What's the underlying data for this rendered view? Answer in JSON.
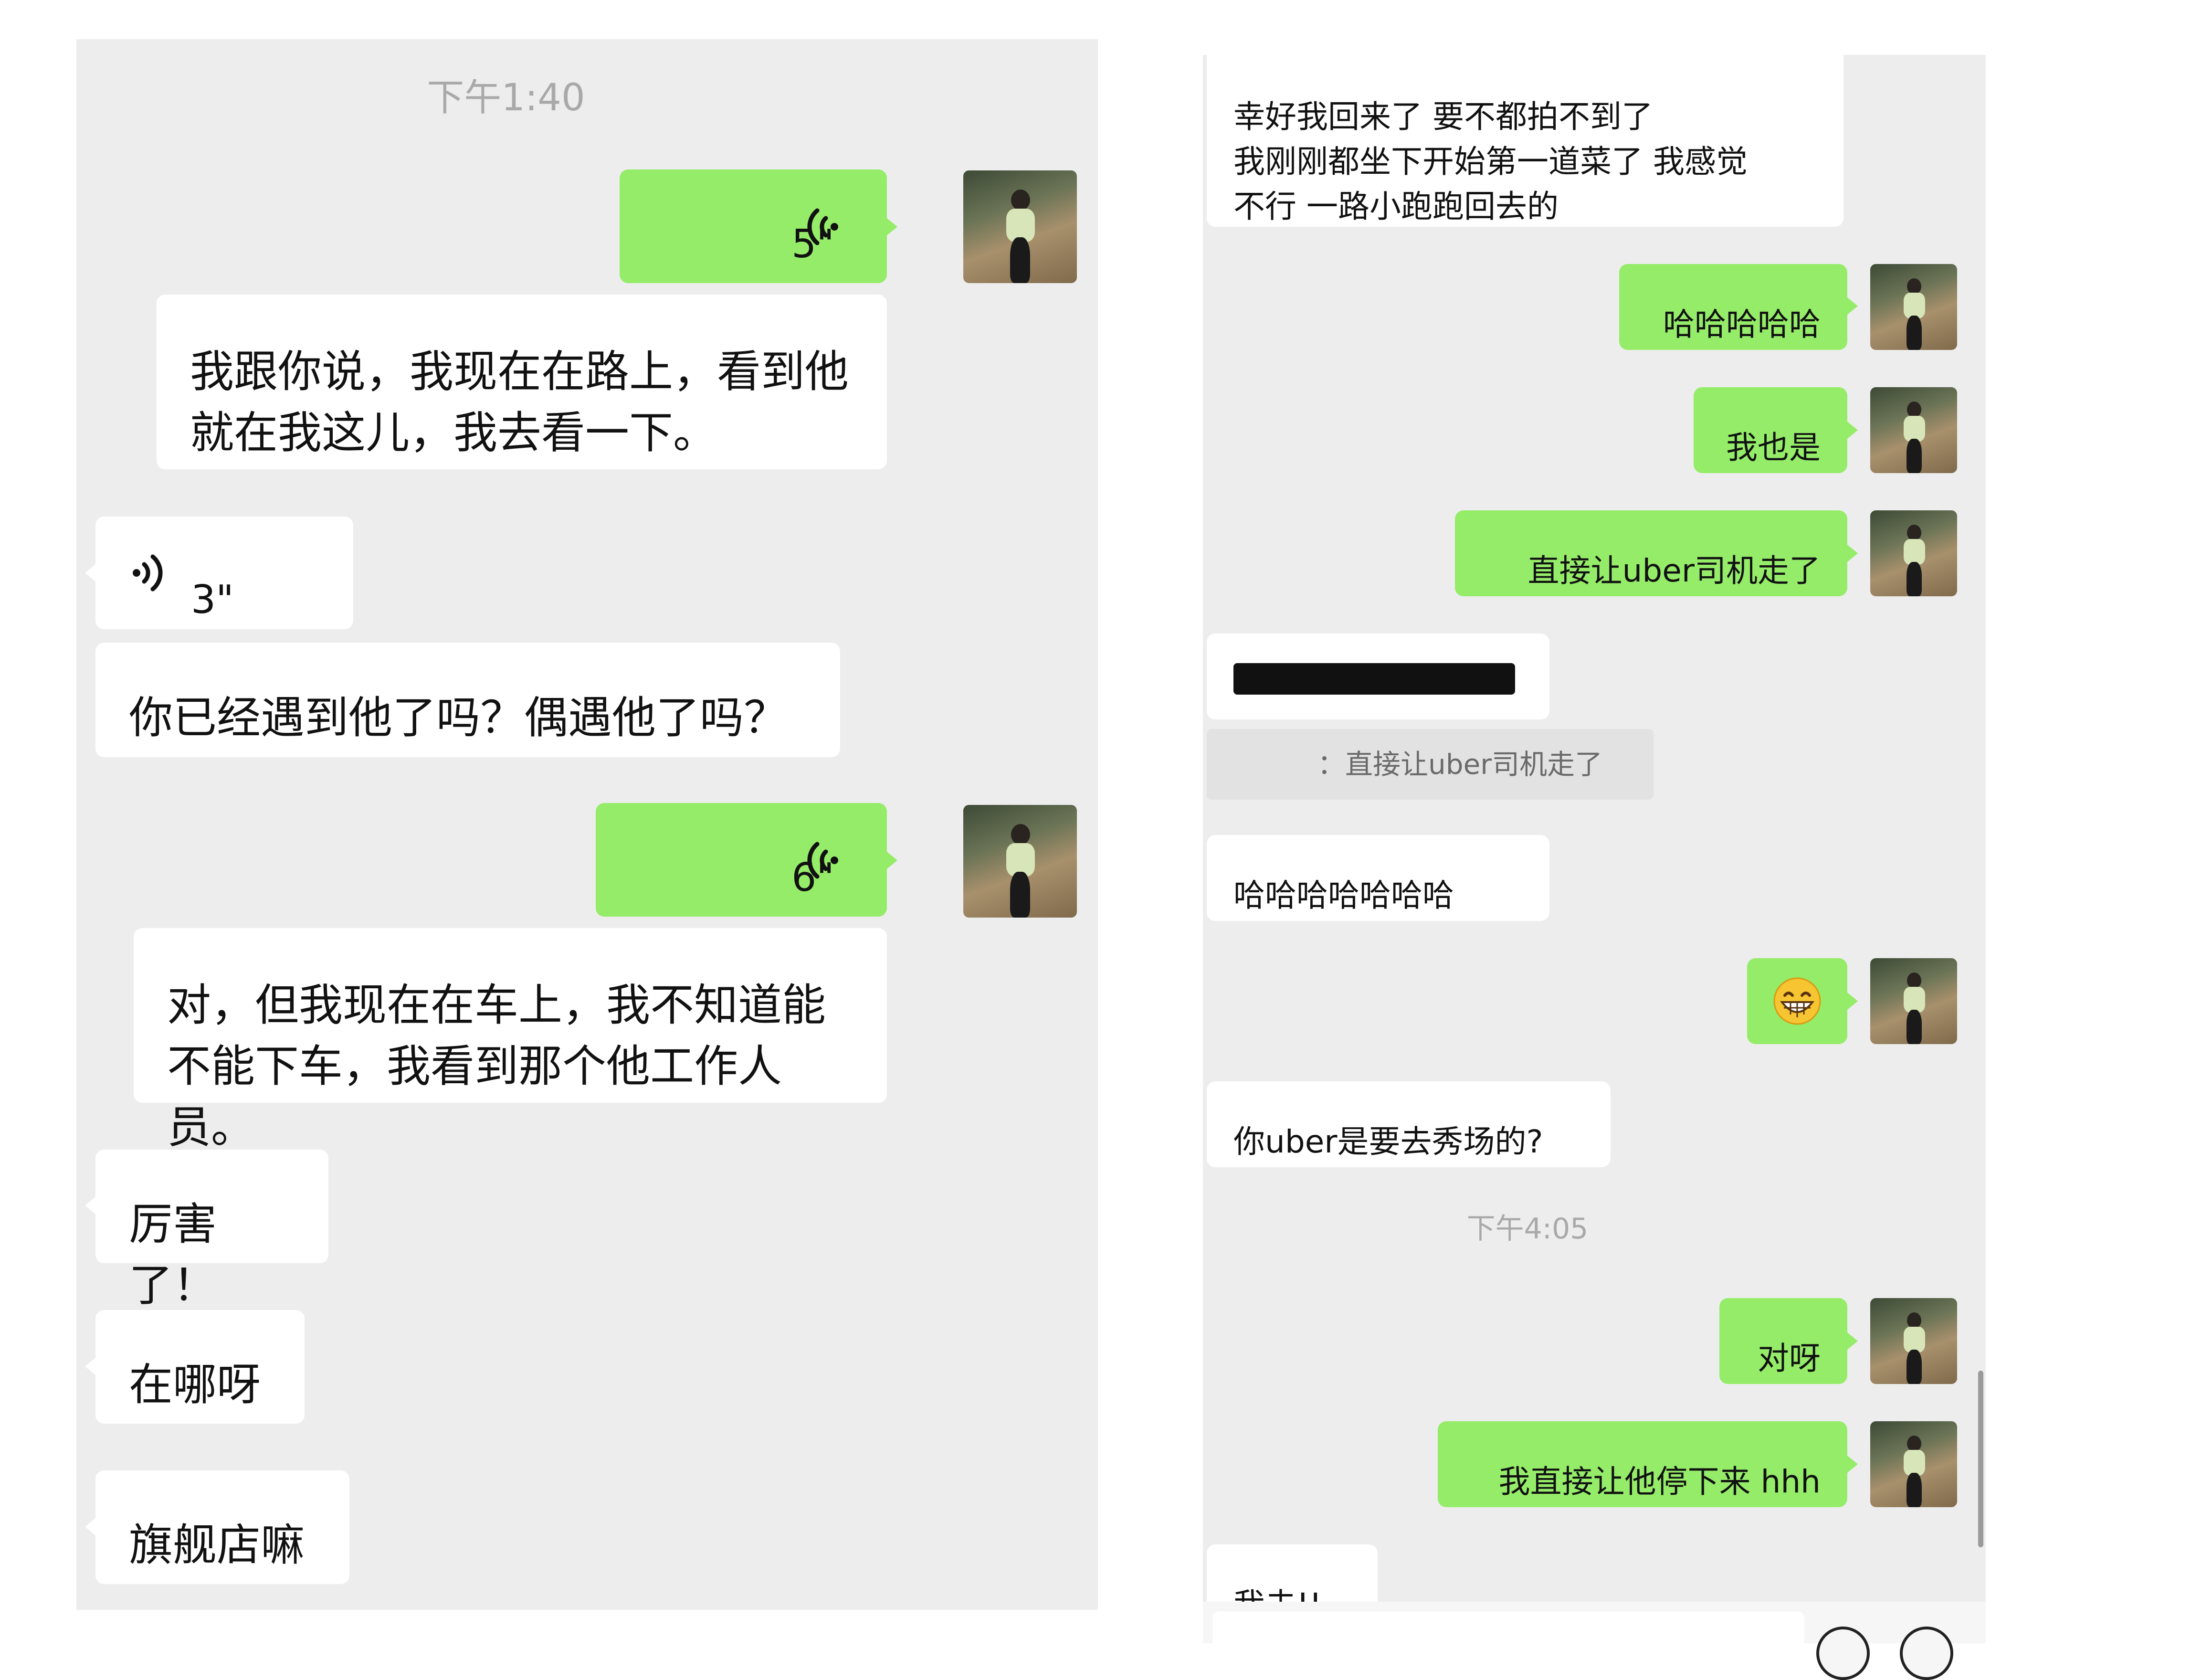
{
  "left": {
    "time": "下午1:40",
    "voice1": {
      "duration": "5\""
    },
    "transcript1": "我跟你说，我现在在路上，看到他\n就在我这儿，我去看一下。",
    "voice2": {
      "duration": "3\""
    },
    "msg1": "你已经遇到他了吗？偶遇他了吗？",
    "voice3": {
      "duration": "6\""
    },
    "transcript2": "对，但我现在在车上，我不知道能\n不能下车，我看到那个他工作人员。",
    "msg2": "厉害了！",
    "msg3": "在哪呀",
    "msg4": "旗舰店嘛"
  },
  "right": {
    "msg1": "幸好我回来了 要不都拍不到了\n我刚刚都坐下开始第一道菜了 我感觉\n不行 一路小跑跑回去的",
    "out1": "哈哈哈哈哈",
    "out2": "我也是",
    "out3": "直接让uber司机走了",
    "quote": "：直接让uber司机走了",
    "msg2": "哈哈哈哈哈哈哈",
    "out4": "😁",
    "msg3": "你uber是要去秀场的?",
    "time": "下午4:05",
    "out5": "对呀",
    "out6": "我直接让他停下来 hhh",
    "msg4": "我去!!"
  },
  "colors": {
    "outgoing_bubble": "#95ec69",
    "incoming_bubble": "#ffffff",
    "chat_background": "#ededed",
    "timestamp": "#a9a9a9"
  },
  "icons": [
    "voice-wave-icon",
    "user-avatar",
    "emoji-icon",
    "plus-icon"
  ]
}
